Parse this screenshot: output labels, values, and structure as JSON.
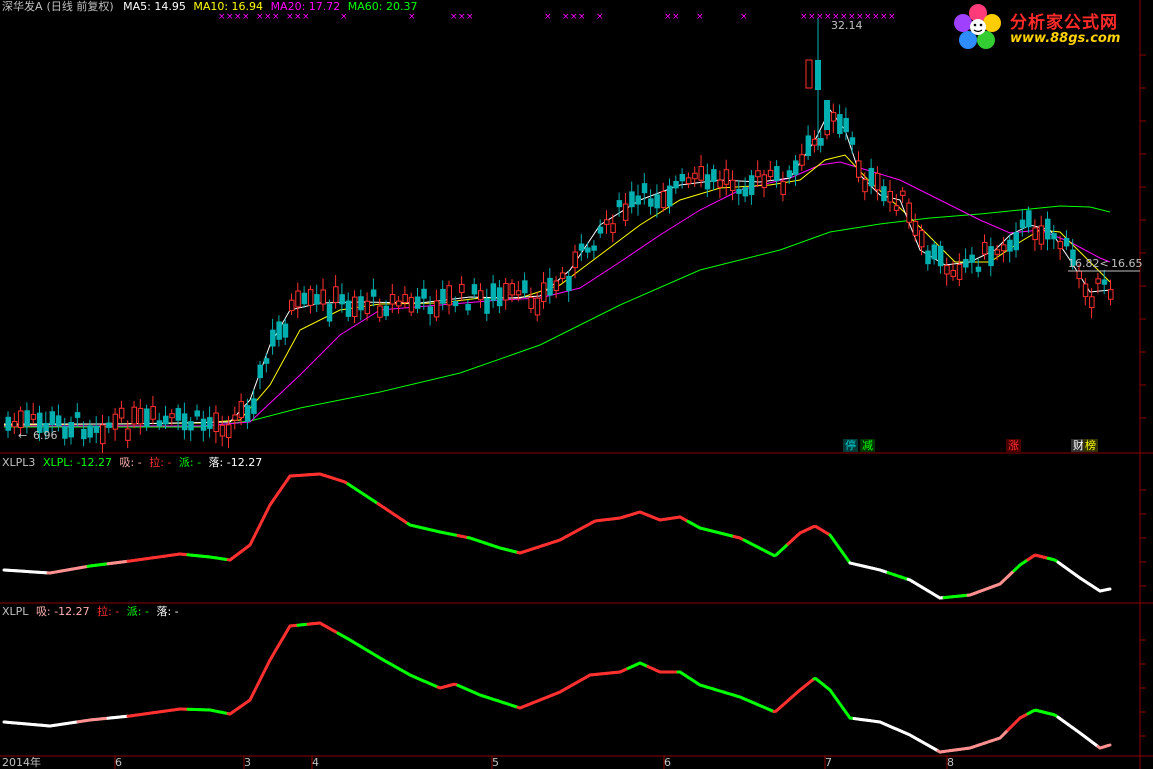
{
  "header": {
    "title": "深华发A",
    "mode": "(日线 前复权)",
    "ma": [
      {
        "label": "MA5: 14.95",
        "color": "#ffffff"
      },
      {
        "label": "MA10: 16.94",
        "color": "#ffff00"
      },
      {
        "label": "MA20: 17.72",
        "color": "#ff00ff"
      },
      {
        "label": "MA60: 20.37",
        "color": "#00ff00"
      }
    ]
  },
  "price_panel": {
    "high_label": "32.14",
    "low_label": "6.96",
    "right_label_1": "16.82",
    "right_label_2": "16.65",
    "badges": [
      {
        "text": "停",
        "color": "#00d0d0"
      },
      {
        "text": "减",
        "color": "#00ff00"
      },
      {
        "text": "涨",
        "color": "#ff3030"
      },
      {
        "text": "财",
        "color": "#ffffff"
      },
      {
        "text": "榜",
        "color": "#ffff00"
      }
    ],
    "marker_color": "#ff00ff"
  },
  "panel2": {
    "name": "XLPL3",
    "label_main": "XLPL: -12.27",
    "label_xi": "吸: -",
    "label_la": "拉: -",
    "label_pai": "派: -",
    "label_luo": "落: -12.27"
  },
  "panel3": {
    "name": "XLPL",
    "label_xi": "吸: -12.27",
    "label_la": "拉: -",
    "label_pai": "派: -",
    "label_luo": "落: -"
  },
  "xaxis": {
    "labels": [
      "2014年",
      "6",
      "3",
      "4",
      "5",
      "6",
      "7",
      "8"
    ]
  },
  "logo": {
    "title": "分析家公式网",
    "url": "www.88gs.com"
  },
  "colors": {
    "up": "#ff3030",
    "down": "#00b0b0",
    "grid": "#8b0000",
    "ma5": "#ffffff",
    "ma10": "#ffff00",
    "ma20": "#ff00ff",
    "ma60": "#00ff00"
  }
}
